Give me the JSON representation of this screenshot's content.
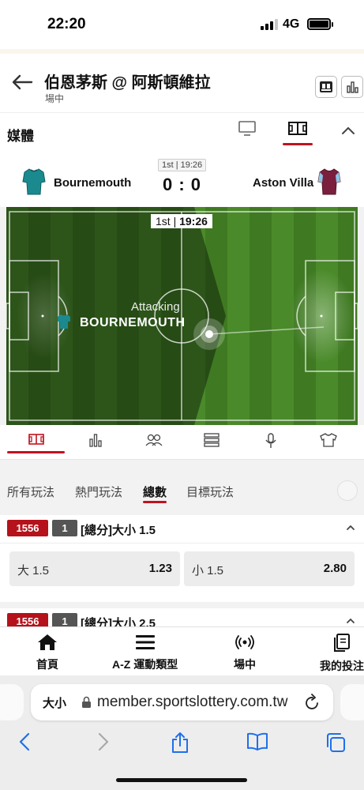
{
  "status_bar": {
    "time": "22:20",
    "network": "4G"
  },
  "header": {
    "title": "伯恩茅斯 @ 阿斯頓維拉",
    "subtitle": "場中"
  },
  "media": {
    "label": "媒體"
  },
  "scoreboard": {
    "period_badge": "1st | 19:26",
    "home_team": "Bournemouth",
    "away_team": "Aston Villa",
    "score": "0 : 0"
  },
  "pitch": {
    "period": "1st",
    "clock": "19:26",
    "status_text": "Attacking",
    "attacking_team": "BOURNEMOUTH"
  },
  "play_tabs": [
    {
      "label": "所有玩法"
    },
    {
      "label": "熱門玩法"
    },
    {
      "label": "總數"
    },
    {
      "label": "目標玩法"
    }
  ],
  "markets": [
    {
      "code": "1556",
      "count": "1",
      "title": "[總分]大小 1.5",
      "selections": [
        {
          "name": "大 1.5",
          "price": "1.23"
        },
        {
          "name": "小 1.5",
          "price": "2.80"
        }
      ]
    },
    {
      "code": "1556",
      "count": "1",
      "title": "[總分]大小 2.5"
    }
  ],
  "bottom_nav": [
    {
      "label": "首頁",
      "icon": "home-icon"
    },
    {
      "label": "A-Z 運動類型",
      "icon": "menu-icon"
    },
    {
      "label": "場中",
      "icon": "live-broadcast-icon"
    },
    {
      "label": "我的投注",
      "icon": "my-bets-icon"
    }
  ],
  "browser": {
    "text_size": "大小",
    "url": "member.sportslottery.com.tw"
  },
  "colors": {
    "accent": "#c1121f",
    "market_code_bg": "#b5121b",
    "pitch_green": "#3f7a22"
  }
}
